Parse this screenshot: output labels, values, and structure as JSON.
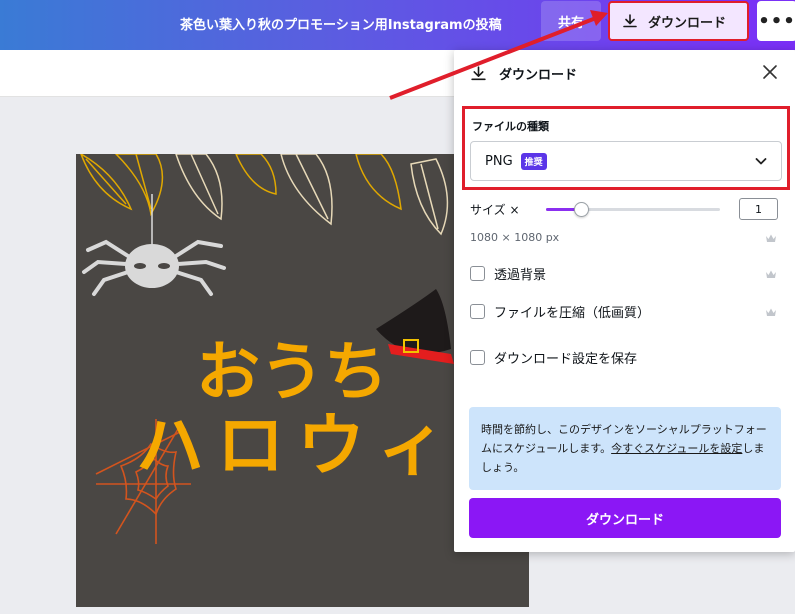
{
  "topbar": {
    "doc_title": "茶色い葉入り秋のプロモーション用Instagramの投稿",
    "share_label": "共有",
    "download_label": "ダウンロード",
    "more_label": "•••"
  },
  "design": {
    "line1": "おうち",
    "line2": "ハロウィン"
  },
  "download_panel": {
    "title": "ダウンロード",
    "file_type_label": "ファイルの種類",
    "file_type_value": "PNG",
    "recommended_badge": "推奨",
    "size_label": "サイズ ×",
    "size_value": "1",
    "size_slider_fraction": 0.2,
    "dimensions": "1080 × 1080 px",
    "options": [
      {
        "label": "透過背景",
        "checked": false,
        "premium": true
      },
      {
        "label": "ファイルを圧縮（低画質）",
        "checked": false,
        "premium": true
      },
      {
        "label": "ダウンロード設定を保存",
        "checked": false,
        "premium": false
      }
    ],
    "info_text_1": "時間を節約し、このデザインをソーシャルプラットフォームにスケジュールします。",
    "info_link": "今すぐスケジュールを設定",
    "info_text_2": "しましょう。",
    "download_button": "ダウンロード"
  },
  "colors": {
    "accent": "#8b17f5",
    "highlight_border": "#e01e2b",
    "info_bg": "#cde4fb",
    "badge": "#5b35e8"
  },
  "icons": [
    "download-icon",
    "close-icon",
    "chevron-down-icon",
    "crown-icon",
    "more-icon"
  ]
}
